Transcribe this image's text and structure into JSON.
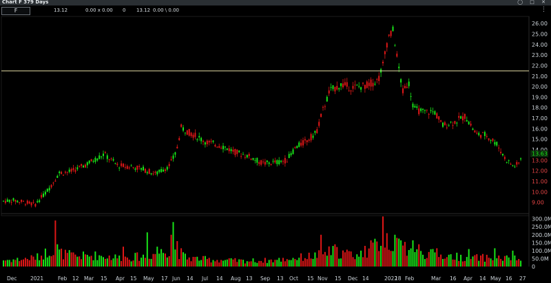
{
  "window": {
    "title": "Chart F 379 Days",
    "controls": "◯ □ ✕"
  },
  "quote": {
    "symbol": "F",
    "last": "13.12",
    "bidask": "0.00 x 0.00",
    "size": "0",
    "price2": "13.12",
    "change": "0.00 \\ 0.00"
  },
  "menu_icon": "more-vert-icon",
  "colors": {
    "up": "#19e619",
    "down": "#e01717",
    "background": "#000000",
    "axis_text": "#cfd6dc",
    "grid": "#1a1a1a",
    "hline": "#e8e0a8",
    "last_price": "#19e619"
  },
  "chart_data": {
    "type": "candlestick",
    "price_axis": {
      "ticks": [
        "26.00",
        "25.00",
        "24.00",
        "23.00",
        "22.00",
        "21.00",
        "20.00",
        "19.00",
        "18.00",
        "17.00",
        "16.00",
        "15.00",
        "14.00",
        "13.00",
        "12.00",
        "11.00",
        "10.00",
        "9.00"
      ],
      "min": 8.0,
      "max": 26.4,
      "red_below": 13.63
    },
    "volume_axis": {
      "ticks": [
        "300.0M",
        "250.0M",
        "200.0M",
        "150.0M",
        "100.0M",
        "50.0M",
        "0"
      ],
      "max": 320
    },
    "horizontal_line": 21.5,
    "last_price_label": "13.63",
    "time_axis": [
      "Dec",
      "2021",
      "Feb",
      "12",
      "Mar",
      "15",
      "Apr",
      "15",
      "May",
      "17",
      "Jun",
      "14",
      "Jul",
      "14",
      "Aug",
      "13",
      "Sep",
      "13",
      "Oct",
      "15",
      "Nov",
      "15",
      "Dec",
      "14",
      "2022",
      "18",
      "Feb",
      "Mar",
      "16",
      "Apr",
      "14",
      "May",
      "16",
      "27"
    ],
    "anchors": [
      [
        0,
        9.1
      ],
      [
        18,
        9.2
      ],
      [
        36,
        9.0
      ],
      [
        50,
        8.8
      ],
      [
        70,
        10.3
      ],
      [
        85,
        11.8
      ],
      [
        100,
        11.9
      ],
      [
        115,
        12.3
      ],
      [
        135,
        13.0
      ],
      [
        150,
        13.6
      ],
      [
        170,
        12.5
      ],
      [
        190,
        12.4
      ],
      [
        205,
        12.2
      ],
      [
        225,
        11.7
      ],
      [
        245,
        12.5
      ],
      [
        255,
        13.8
      ],
      [
        262,
        16.1
      ],
      [
        275,
        15.6
      ],
      [
        300,
        14.7
      ],
      [
        320,
        14.4
      ],
      [
        340,
        13.8
      ],
      [
        360,
        13.4
      ],
      [
        380,
        12.7
      ],
      [
        400,
        12.8
      ],
      [
        415,
        13.0
      ],
      [
        428,
        14.2
      ],
      [
        445,
        14.9
      ],
      [
        458,
        15.6
      ],
      [
        468,
        17.8
      ],
      [
        478,
        19.6
      ],
      [
        495,
        20.2
      ],
      [
        510,
        19.9
      ],
      [
        530,
        20.1
      ],
      [
        548,
        20.6
      ],
      [
        555,
        22.0
      ],
      [
        562,
        24.6
      ],
      [
        570,
        25.3
      ],
      [
        576,
        22.5
      ],
      [
        584,
        19.5
      ],
      [
        592,
        20.5
      ],
      [
        600,
        17.9
      ],
      [
        612,
        17.6
      ],
      [
        630,
        17.6
      ],
      [
        642,
        16.3
      ],
      [
        660,
        16.7
      ],
      [
        675,
        17.2
      ],
      [
        690,
        15.5
      ],
      [
        705,
        15.4
      ],
      [
        720,
        14.6
      ],
      [
        732,
        13.2
      ],
      [
        745,
        12.4
      ],
      [
        752,
        12.7
      ],
      [
        758,
        13.6
      ]
    ],
    "volume_anchors": [
      [
        0,
        40
      ],
      [
        30,
        45
      ],
      [
        55,
        60
      ],
      [
        75,
        110
      ],
      [
        90,
        80
      ],
      [
        110,
        65
      ],
      [
        140,
        70
      ],
      [
        175,
        55
      ],
      [
        210,
        65
      ],
      [
        250,
        110
      ],
      [
        270,
        55
      ],
      [
        300,
        45
      ],
      [
        350,
        35
      ],
      [
        400,
        40
      ],
      [
        430,
        55
      ],
      [
        460,
        70
      ],
      [
        480,
        95
      ],
      [
        520,
        70
      ],
      [
        555,
        160
      ],
      [
        570,
        140
      ],
      [
        585,
        110
      ],
      [
        605,
        90
      ],
      [
        640,
        70
      ],
      [
        680,
        55
      ],
      [
        720,
        55
      ],
      [
        758,
        45
      ]
    ],
    "volume_spikes": [
      [
        78,
        290
      ],
      [
        82,
        140
      ],
      [
        178,
        125
      ],
      [
        212,
        215
      ],
      [
        228,
        125
      ],
      [
        249,
        200
      ],
      [
        251,
        280
      ],
      [
        256,
        160
      ],
      [
        262,
        115
      ],
      [
        465,
        200
      ],
      [
        485,
        140
      ],
      [
        530,
        130
      ],
      [
        552,
        130
      ],
      [
        556,
        315
      ],
      [
        560,
        210
      ],
      [
        572,
        200
      ],
      [
        580,
        165
      ],
      [
        586,
        155
      ],
      [
        598,
        165
      ],
      [
        606,
        140
      ],
      [
        632,
        115
      ],
      [
        680,
        110
      ],
      [
        716,
        115
      ],
      [
        744,
        100
      ]
    ]
  }
}
